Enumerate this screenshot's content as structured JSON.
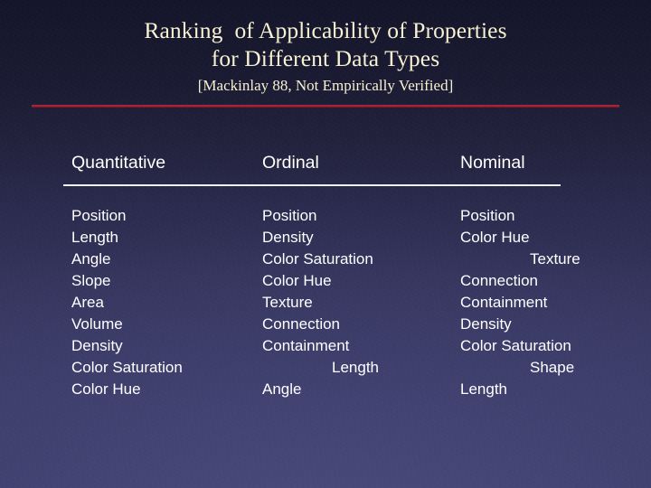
{
  "slide": {
    "title_lines": [
      "Ranking  of Applicability of Properties",
      "for Different Data Types"
    ],
    "subtitle": "[Mackinlay 88, Not Empirically Verified]",
    "colors": {
      "title_text": "#f7f2d2",
      "body_text": "#ffffff",
      "rule_red": "#9e2230",
      "rule_white": "#f0f0f5",
      "background_top": "#14142a",
      "background_bottom": "#40406e"
    }
  },
  "table": {
    "columns": [
      {
        "header": "Quantitative",
        "items": [
          {
            "label": "Position",
            "indent": false
          },
          {
            "label": "Length",
            "indent": false
          },
          {
            "label": "Angle",
            "indent": false
          },
          {
            "label": "Slope",
            "indent": false
          },
          {
            "label": "Area",
            "indent": false
          },
          {
            "label": "Volume",
            "indent": false
          },
          {
            "label": "Density",
            "indent": false
          },
          {
            "label": "Color Saturation",
            "indent": false
          },
          {
            "label": "Color Hue",
            "indent": false
          }
        ]
      },
      {
        "header": "Ordinal",
        "items": [
          {
            "label": "Position",
            "indent": false
          },
          {
            "label": "Density",
            "indent": false
          },
          {
            "label": "Color Saturation",
            "indent": false
          },
          {
            "label": "Color Hue",
            "indent": false
          },
          {
            "label": "Texture",
            "indent": false
          },
          {
            "label": "Connection",
            "indent": false
          },
          {
            "label": "Containment",
            "indent": false
          },
          {
            "label": "Length",
            "indent": true
          },
          {
            "label": "Angle",
            "indent": false
          }
        ]
      },
      {
        "header": "Nominal",
        "items": [
          {
            "label": "Position",
            "indent": false
          },
          {
            "label": "Color Hue",
            "indent": false
          },
          {
            "label": "Texture",
            "indent": true
          },
          {
            "label": "Connection",
            "indent": false
          },
          {
            "label": "Containment",
            "indent": false
          },
          {
            "label": "Density",
            "indent": false
          },
          {
            "label": "Color Saturation",
            "indent": false
          },
          {
            "label": "Shape",
            "indent": true
          },
          {
            "label": "Length",
            "indent": false
          }
        ]
      }
    ]
  }
}
